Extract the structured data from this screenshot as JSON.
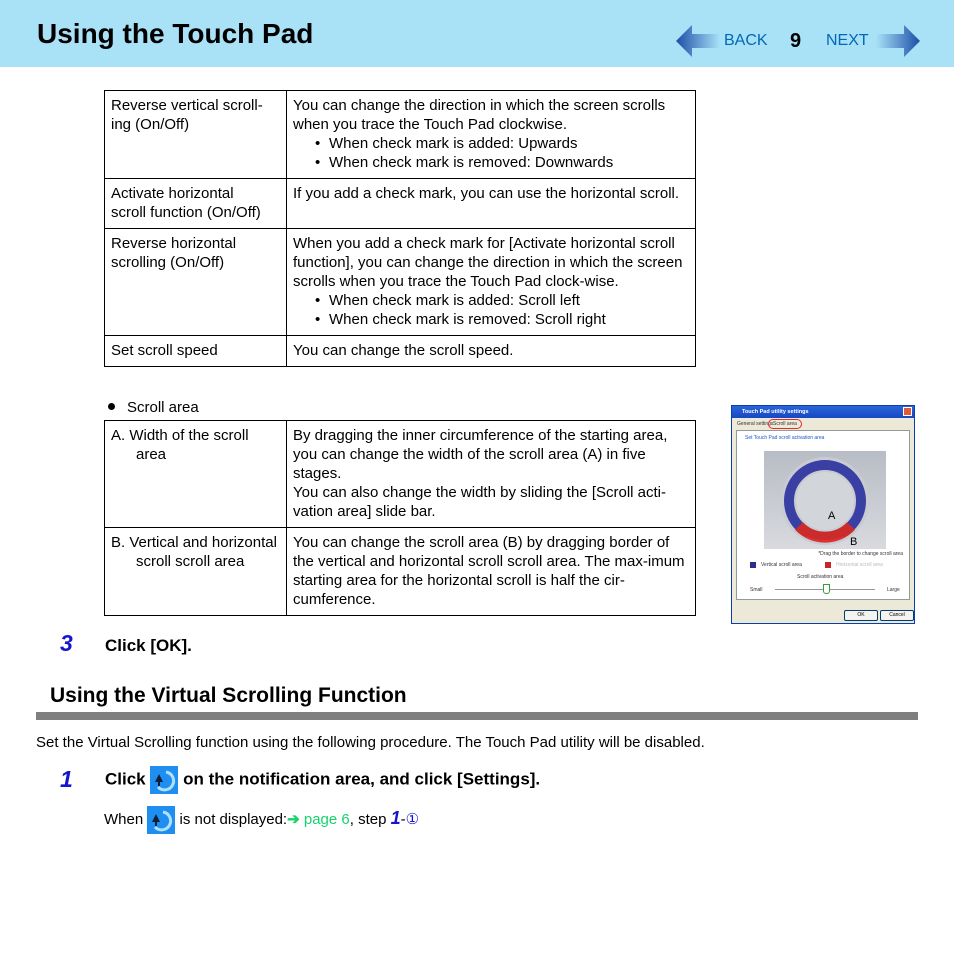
{
  "header": {
    "title": "Using the Touch Pad",
    "back_label": "BACK",
    "page_number": "9",
    "next_label": "NEXT",
    "background_color": "#a9e1f7",
    "nav_text_color": "#0068b5"
  },
  "table1": {
    "rows": [
      {
        "setting": "Reverse vertical scroll-ing (On/Off)",
        "setting_line1": "Reverse vertical scroll-",
        "setting_line2": "ing (On/Off)",
        "description": "You can change the direction in which the screen scrolls when you trace the Touch Pad clockwise.",
        "bullets": [
          "When check mark is added: Upwards",
          "When check mark is removed: Downwards"
        ]
      },
      {
        "setting_line1": "Activate horizontal",
        "setting_line2": "scroll function (On/Off)",
        "description": "If you add a check mark, you can use the horizontal scroll."
      },
      {
        "setting_line1": "Reverse horizontal",
        "setting_line2": "scrolling (On/Off)",
        "description": "When you add a check mark for [Activate horizontal scroll function], you can change the direction in which the screen scrolls when you trace the Touch Pad clock-wise.",
        "bullets": [
          "When check mark is added: Scroll left",
          "When check mark is removed: Scroll right"
        ]
      },
      {
        "setting_line1": "Set scroll speed",
        "description": "You can change the scroll speed."
      }
    ]
  },
  "scroll_area": {
    "label": "Scroll area",
    "rows": [
      {
        "setting": "A.  Width of the scroll area",
        "description": "By dragging the inner circumference of the starting area, you can change the width of the scroll area (A) in five stages.",
        "description2": "You can also change the width by sliding the [Scroll acti-vation area] slide bar."
      },
      {
        "setting": "B.  Vertical and horizontal scroll scroll area",
        "description": "You can change the scroll area (B) by dragging border of the vertical and horizontal scroll scroll area. The max-imum starting area for the horizontal scroll is half the cir-cumference."
      }
    ]
  },
  "screenshot": {
    "window_title": "Touch Pad utility settings",
    "tabs": [
      "General settings",
      "Scroll area"
    ],
    "group_label": "Set Touch Pad scroll activation area",
    "label_a": "A",
    "label_b": "B",
    "hint": "*Drag the border to change scroll area",
    "legend_vertical": "Vertical scroll area",
    "legend_horizontal": "Horizontal scroll area",
    "slider_label": "Scroll activation area",
    "slider_min": "Small",
    "slider_max": "Large",
    "ok": "OK",
    "cancel": "Cancel"
  },
  "step3": {
    "number": "3",
    "text": "Click [OK]."
  },
  "section": {
    "heading": "Using the Virtual Scrolling Function",
    "intro": "Set the Virtual Scrolling function using the following procedure. The Touch Pad utility will be disabled."
  },
  "step1": {
    "number": "1",
    "text_before": "Click",
    "text_after": "on the notification area, and click [Settings].",
    "note_before": "When",
    "note_after": "is not displayed:",
    "link_arrow": "➔",
    "link_text": "page 6",
    "note_tail": ", step",
    "step_ref": "1",
    "step_sep": "-",
    "step_circle": "①"
  }
}
